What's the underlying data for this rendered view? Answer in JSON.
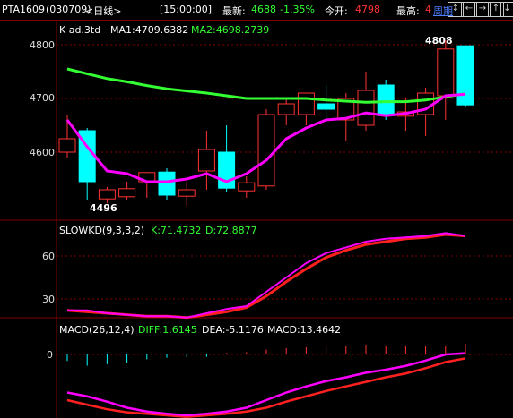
{
  "header": {
    "symbol": "PTA1609",
    "code": "(030709)",
    "period": "<日线>",
    "time": "[15:00:00]",
    "latest_label": "最新:",
    "latest_value": "4688",
    "change_pct": "-1.35%",
    "open_label": "今开:",
    "open_value": "4798",
    "high_label": "最高:",
    "high_value": "4",
    "cycle_link": "周期",
    "nav_icons": [
      "↕",
      "←",
      "→",
      "↑",
      "↓"
    ]
  },
  "main_panel": {
    "title": "K  ad.3td",
    "ma1": "MA1:4709.6382",
    "ma2": "MA2:4698.2739",
    "y_ticks": [
      "4800",
      "4700",
      "4600"
    ],
    "high_marker": "4808",
    "low_marker": "4496"
  },
  "kd_panel": {
    "title": "SLOWKD(9,3,3,2)",
    "k": "K:71.4732",
    "d": "D:72.8877",
    "y_ticks": [
      "60",
      "30"
    ]
  },
  "macd_panel": {
    "title": "MACD(26,12,4)",
    "diff": "DIFF:1.6145",
    "dea": "DEA:-5.1176",
    "macd": "MACD:13.4642",
    "y_ticks": [
      "0"
    ]
  },
  "colors": {
    "up": "#ff3232",
    "down": "#00ffff",
    "ma1": "#ff00ff",
    "ma2": "#33ff33",
    "green_text": "#33ff33",
    "border": "#800000",
    "grid": "#800000"
  },
  "chart_data": [
    {
      "type": "candlestick",
      "title": "K  ad.3td",
      "ylim": [
        4490,
        4830
      ],
      "candles": [
        {
          "o": 4600,
          "h": 4670,
          "l": 4590,
          "c": 4625
        },
        {
          "o": 4640,
          "h": 4645,
          "l": 4510,
          "c": 4545
        },
        {
          "o": 4513,
          "h": 4535,
          "l": 4505,
          "c": 4530
        },
        {
          "o": 4517,
          "h": 4545,
          "l": 4512,
          "c": 4532
        },
        {
          "o": 4545,
          "h": 4555,
          "l": 4515,
          "c": 4562
        },
        {
          "o": 4563,
          "h": 4570,
          "l": 4510,
          "c": 4520
        },
        {
          "o": 4518,
          "h": 4545,
          "l": 4500,
          "c": 4530
        },
        {
          "o": 4565,
          "h": 4640,
          "l": 4530,
          "c": 4605
        },
        {
          "o": 4600,
          "h": 4650,
          "l": 4525,
          "c": 4533
        },
        {
          "o": 4528,
          "h": 4555,
          "l": 4515,
          "c": 4543
        },
        {
          "o": 4537,
          "h": 4680,
          "l": 4530,
          "c": 4670
        },
        {
          "o": 4670,
          "h": 4700,
          "l": 4650,
          "c": 4690
        },
        {
          "o": 4670,
          "h": 4710,
          "l": 4650,
          "c": 4710
        },
        {
          "o": 4690,
          "h": 4725,
          "l": 4660,
          "c": 4680
        },
        {
          "o": 4660,
          "h": 4710,
          "l": 4620,
          "c": 4700
        },
        {
          "o": 4650,
          "h": 4750,
          "l": 4640,
          "c": 4715
        },
        {
          "o": 4725,
          "h": 4735,
          "l": 4660,
          "c": 4668
        },
        {
          "o": 4667,
          "h": 4700,
          "l": 4640,
          "c": 4675
        },
        {
          "o": 4670,
          "h": 4720,
          "l": 4630,
          "c": 4710
        },
        {
          "o": 4705,
          "h": 4808,
          "l": 4660,
          "c": 4792
        },
        {
          "o": 4798,
          "h": 4798,
          "l": 4685,
          "c": 4688
        }
      ],
      "ma1": [
        4660,
        4610,
        4565,
        4560,
        4545,
        4545,
        4550,
        4560,
        4545,
        4560,
        4585,
        4625,
        4645,
        4660,
        4663,
        4673,
        4668,
        4672,
        4680,
        4705,
        4708
      ],
      "ma2": [
        4755,
        4746,
        4737,
        4731,
        4724,
        4718,
        4714,
        4710,
        4705,
        4700,
        4700,
        4700,
        4700,
        4697,
        4695,
        4693,
        4694,
        4694,
        4697,
        4703,
        4709
      ],
      "markers": {
        "high": 4808,
        "low": 4496
      }
    },
    {
      "type": "line",
      "title": "SLOWKD(9,3,3,2)",
      "ylim": [
        0,
        100
      ],
      "series": [
        {
          "name": "K",
          "values": [
            22,
            22,
            20,
            19,
            18,
            18,
            17,
            20,
            23,
            25,
            35,
            45,
            55,
            62,
            66,
            70,
            72,
            73,
            74,
            76,
            74
          ]
        },
        {
          "name": "D",
          "values": [
            22,
            21,
            20,
            19,
            18,
            18,
            17,
            19,
            21,
            24,
            32,
            42,
            51,
            59,
            64,
            68,
            70,
            72,
            73,
            75,
            74
          ]
        }
      ]
    },
    {
      "type": "line",
      "title": "MACD(26,12,4)",
      "ylim": [
        -90,
        10
      ],
      "series": [
        {
          "name": "DIFF",
          "values": [
            -50,
            -55,
            -62,
            -70,
            -75,
            -78,
            -80,
            -78,
            -75,
            -70,
            -60,
            -50,
            -42,
            -35,
            -30,
            -24,
            -20,
            -15,
            -8,
            0,
            1.6
          ]
        },
        {
          "name": "DEA",
          "values": [
            -60,
            -66,
            -72,
            -76,
            -78,
            -80,
            -82,
            -80,
            -78,
            -75,
            -70,
            -62,
            -55,
            -48,
            -42,
            -36,
            -30,
            -25,
            -18,
            -10,
            -5.1
          ]
        },
        {
          "name": "MACD",
          "values": [
            -8,
            -14,
            -12,
            -10,
            -6,
            -4,
            -3,
            -3,
            2,
            3,
            6,
            8,
            9,
            10,
            10,
            12,
            10,
            10,
            10,
            10,
            13.5
          ]
        }
      ]
    }
  ]
}
